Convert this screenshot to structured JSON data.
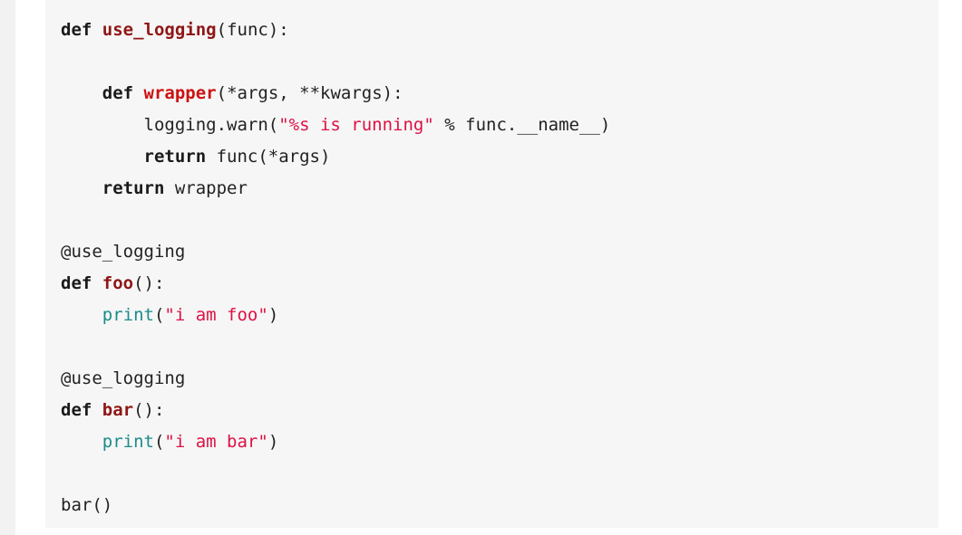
{
  "page": {
    "background_color": "#ffffff",
    "gutter_color": "#f2f2f2",
    "code_block_background": "#f6f6f6",
    "language": "python"
  },
  "theme": {
    "keyword_color": "#1a1a1a",
    "function_name_color": "#8f1616",
    "inner_function_color": "#cc1111",
    "string_color": "#dd1144",
    "builtin_color": "#1a8b8b",
    "plain_text_color": "#222222"
  },
  "code": {
    "lines": [
      {
        "index": 1,
        "text": "def use_logging(func):",
        "tokens": [
          {
            "t": "def",
            "c": "kw"
          },
          {
            "t": " ",
            "c": "plain"
          },
          {
            "t": "use_logging",
            "c": "fn-def"
          },
          {
            "t": "(func):",
            "c": "plain"
          }
        ]
      },
      {
        "index": 2,
        "text": "",
        "tokens": []
      },
      {
        "index": 3,
        "text": "    def wrapper(*args, **kwargs):",
        "tokens": [
          {
            "t": "    ",
            "c": "plain"
          },
          {
            "t": "def",
            "c": "kw"
          },
          {
            "t": " ",
            "c": "plain"
          },
          {
            "t": "wrapper",
            "c": "fn-inner"
          },
          {
            "t": "(*args, **kwargs):",
            "c": "plain"
          }
        ]
      },
      {
        "index": 4,
        "text": "        logging.warn(\"%s is running\" % func.__name__)",
        "tokens": [
          {
            "t": "        logging.warn(",
            "c": "plain"
          },
          {
            "t": "\"%s is running\"",
            "c": "str"
          },
          {
            "t": " % func.__name__)",
            "c": "plain"
          }
        ]
      },
      {
        "index": 5,
        "text": "        return func(*args)",
        "tokens": [
          {
            "t": "        ",
            "c": "plain"
          },
          {
            "t": "return",
            "c": "kw"
          },
          {
            "t": " func(*args)",
            "c": "plain"
          }
        ]
      },
      {
        "index": 6,
        "text": "    return wrapper",
        "tokens": [
          {
            "t": "    ",
            "c": "plain"
          },
          {
            "t": "return",
            "c": "kw"
          },
          {
            "t": " wrapper",
            "c": "plain"
          }
        ]
      },
      {
        "index": 7,
        "text": "",
        "tokens": []
      },
      {
        "index": 8,
        "text": "@use_logging",
        "tokens": [
          {
            "t": "@use_logging",
            "c": "decorator"
          }
        ]
      },
      {
        "index": 9,
        "text": "def foo():",
        "tokens": [
          {
            "t": "def",
            "c": "kw"
          },
          {
            "t": " ",
            "c": "plain"
          },
          {
            "t": "foo",
            "c": "fn-def"
          },
          {
            "t": "():",
            "c": "plain"
          }
        ]
      },
      {
        "index": 10,
        "text": "    print(\"i am foo\")",
        "tokens": [
          {
            "t": "    ",
            "c": "plain"
          },
          {
            "t": "print",
            "c": "builtin"
          },
          {
            "t": "(",
            "c": "plain"
          },
          {
            "t": "\"i am foo\"",
            "c": "str"
          },
          {
            "t": ")",
            "c": "plain"
          }
        ]
      },
      {
        "index": 11,
        "text": "",
        "tokens": []
      },
      {
        "index": 12,
        "text": "@use_logging",
        "tokens": [
          {
            "t": "@use_logging",
            "c": "decorator"
          }
        ]
      },
      {
        "index": 13,
        "text": "def bar():",
        "tokens": [
          {
            "t": "def",
            "c": "kw"
          },
          {
            "t": " ",
            "c": "plain"
          },
          {
            "t": "bar",
            "c": "fn-def"
          },
          {
            "t": "():",
            "c": "plain"
          }
        ]
      },
      {
        "index": 14,
        "text": "    print(\"i am bar\")",
        "tokens": [
          {
            "t": "    ",
            "c": "plain"
          },
          {
            "t": "print",
            "c": "builtin"
          },
          {
            "t": "(",
            "c": "plain"
          },
          {
            "t": "\"i am bar\"",
            "c": "str"
          },
          {
            "t": ")",
            "c": "plain"
          }
        ]
      },
      {
        "index": 15,
        "text": "",
        "tokens": []
      },
      {
        "index": 16,
        "text": "bar()",
        "tokens": [
          {
            "t": "bar()",
            "c": "plain"
          }
        ]
      }
    ]
  }
}
